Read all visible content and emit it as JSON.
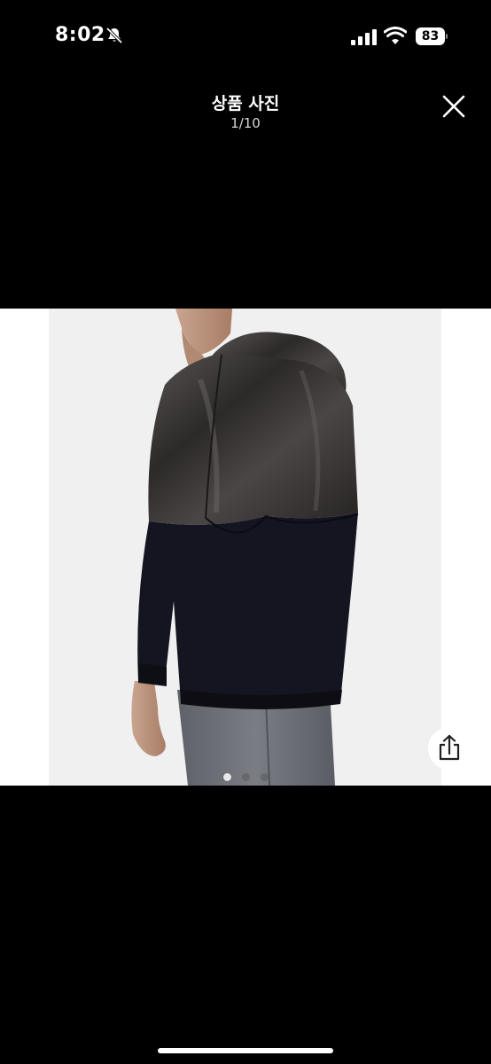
{
  "status_bar": {
    "time": "8:02",
    "battery_level": "83",
    "icons": [
      "mute-bell-icon",
      "cellular-signal-icon",
      "wifi-icon",
      "battery-icon"
    ]
  },
  "viewer": {
    "title": "상품 사진",
    "counter": "1/10",
    "close_icon": "close-icon"
  },
  "photo": {
    "subject_colors": {
      "background": "#f0f0f0",
      "jacket_top": "#3a3636",
      "jacket_bottom": "#12131a",
      "pants": "#6b6e75"
    }
  },
  "share": {
    "icon": "share-icon"
  },
  "pager": {
    "visible_dots": 3,
    "active_index": 0
  }
}
